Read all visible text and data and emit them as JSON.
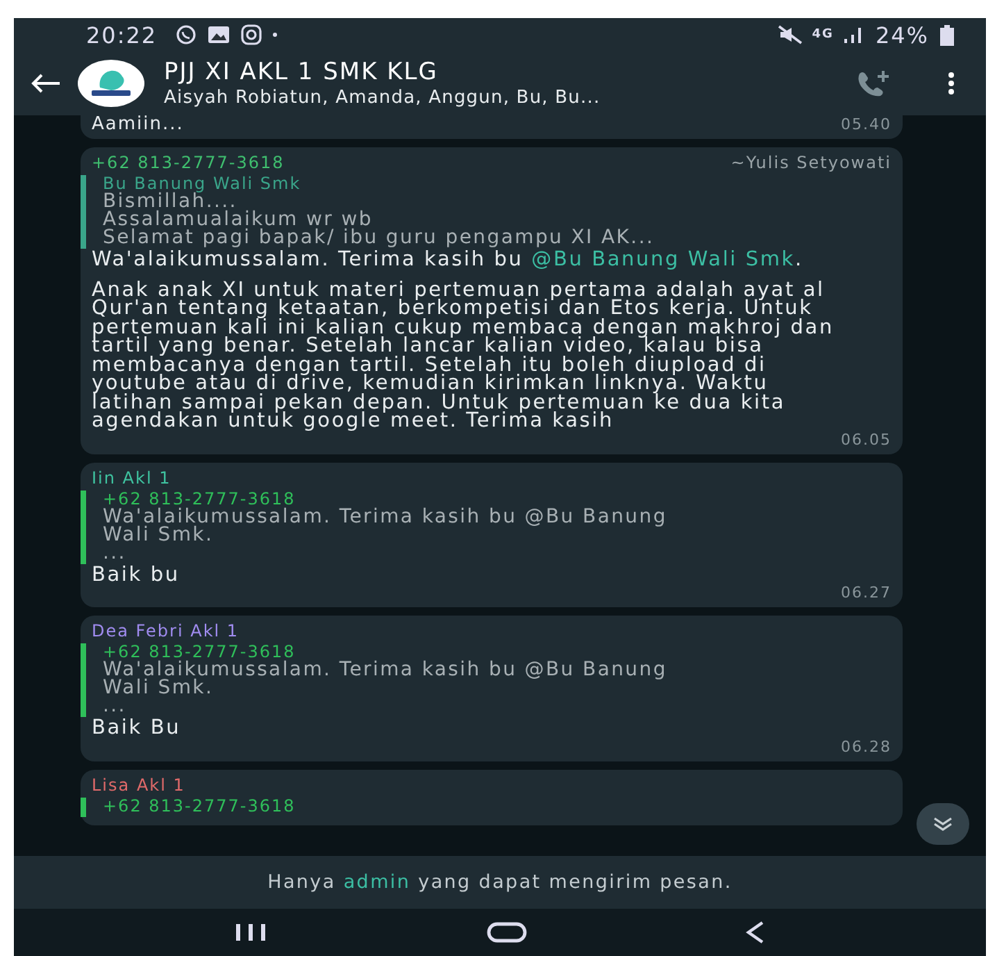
{
  "status_bar": {
    "time": "20:22",
    "network": "4G",
    "battery": "24%"
  },
  "header": {
    "title": "PJJ XI AKL 1 SMK KLG",
    "subtitle": "Aisyah Robiatun, Amanda, Anggun, Bu, Bu..."
  },
  "previous_message": {
    "text": "Aamiin...",
    "time": "05.40"
  },
  "messages": [
    {
      "sender": "+62 813-2777-3618",
      "color": "#3fbf6f",
      "sender_name": "~Yulis Setyowati",
      "quote": {
        "author": "Bu Banung Wali Smk",
        "color": "#3aa58a",
        "lines": [
          "Bismillah....",
          "Assalamualaikum wr wb",
          "Selamat pagi  bapak/ ibu guru pengampu XI AK..."
        ]
      },
      "paragraphs": [
        {
          "text": "Wa'alaikumussalam. Terima kasih bu ",
          "mention": "@Bu Banung Wali Smk",
          "after": "."
        },
        {
          "text": "Anak anak XI untuk materi pertemuan pertama adalah ayat al Qur'an tentang ketaatan, berkompetisi dan Etos kerja. Untuk pertemuan kali ini kalian cukup membaca dengan makhroj dan tartil yang benar. Setelah lancar kalian video, kalau bisa membacanya dengan tartil. Setelah itu boleh diupload di youtube atau di drive, kemudian kirimkan linknya. Waktu latihan sampai pekan depan. Untuk pertemuan ke dua kita agendakan untuk google meet. Terima kasih"
        }
      ],
      "time": "06.05"
    },
    {
      "sender": "Iin Akl 1",
      "color": "#3fc3a0",
      "quote": {
        "author": "+62 813-2777-3618",
        "color": "#2fbf5a",
        "lines": [
          "Wa'alaikumussalam. Terima kasih bu @Bu Banung Wali Smk.",
          "..."
        ]
      },
      "paragraphs": [
        {
          "text": "Baik bu"
        }
      ],
      "time": "06.27"
    },
    {
      "sender": "Dea Febri Akl 1",
      "color": "#a08cf0",
      "quote": {
        "author": "+62 813-2777-3618",
        "color": "#2fbf5a",
        "lines": [
          "Wa'alaikumussalam. Terima kasih bu @Bu Banung Wali Smk.",
          "..."
        ]
      },
      "paragraphs": [
        {
          "text": "Baik Bu"
        }
      ],
      "time": "06.28"
    },
    {
      "sender": "Lisa Akl 1",
      "color": "#e06a6a",
      "quote": {
        "author": "+62 813-2777-3618",
        "color": "#2fbf5a"
      }
    }
  ],
  "footer": {
    "before": "Hanya ",
    "link": "admin",
    "after": " yang dapat mengirim pesan."
  }
}
